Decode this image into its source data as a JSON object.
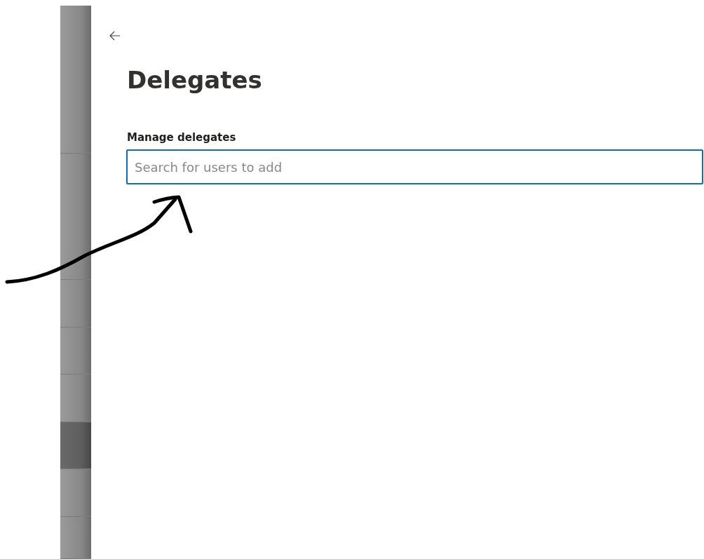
{
  "sidebar": {
    "items": [
      {
        "selected": false
      },
      {
        "selected": false
      },
      {
        "selected": false
      },
      {
        "selected": false
      },
      {
        "selected": false
      },
      {
        "selected": true
      },
      {
        "selected": false
      },
      {
        "selected": false
      }
    ]
  },
  "page": {
    "title": "Delegates",
    "section_label": "Manage delegates",
    "search": {
      "placeholder": "Search for users to add",
      "focused": true
    }
  }
}
